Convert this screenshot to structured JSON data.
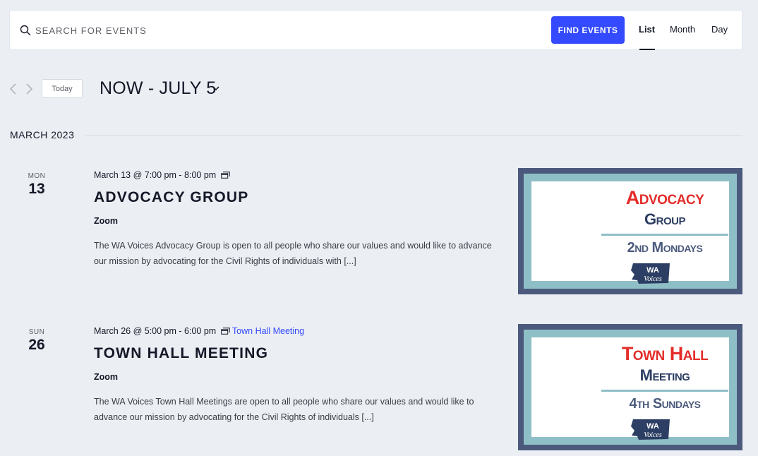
{
  "search": {
    "placeholder": "SEARCH FOR EVENTS",
    "button_label": "FIND EVENTS"
  },
  "views": [
    {
      "label": "List",
      "active": true
    },
    {
      "label": "Month",
      "active": false
    },
    {
      "label": "Day",
      "active": false
    }
  ],
  "nav": {
    "today_label": "Today",
    "range_title": "NOW - JULY 5"
  },
  "month_label": "MARCH 2023",
  "events": [
    {
      "dow": "MON",
      "day": "13",
      "datetime": "March 13 @ 7:00 pm - 8:00 pm",
      "series_link": "",
      "title": "ADVOCACY GROUP",
      "venue": "Zoom",
      "description": "The WA Voices Advocacy Group is open to all people who share our values and would like to advance our mission by advocating for the Civil Rights of individuals with [...]",
      "image": {
        "line1": "Advocacy",
        "line2": "Group",
        "line3": "2nd Mondays",
        "logo_text": "WA Voices"
      }
    },
    {
      "dow": "SUN",
      "day": "26",
      "datetime": "March 26 @ 5:00 pm - 6:00 pm",
      "series_link": "Town Hall Meeting",
      "title": "TOWN HALL MEETING",
      "venue": "Zoom",
      "description": "The WA Voices Town Hall Meetings are open to all people who share our values and would like to advance our mission by advocating for the Civil Rights of individuals [...]",
      "image": {
        "line1": "Town Hall",
        "line2": "Meeting",
        "line3": "4th Sundays",
        "logo_text": "WA Voices"
      }
    }
  ],
  "colors": {
    "accent": "#334aff",
    "background": "#ebeef3",
    "image_red": "#e32d2a",
    "image_navy": "#2c3e63",
    "image_teal": "#8fbfc6",
    "image_frame": "#4b5a7c"
  },
  "icons": {
    "search": "search-icon",
    "prev": "chevron-left-icon",
    "next": "chevron-right-icon",
    "range_dropdown": "chevron-down-icon",
    "recurring": "recurring-event-icon"
  }
}
